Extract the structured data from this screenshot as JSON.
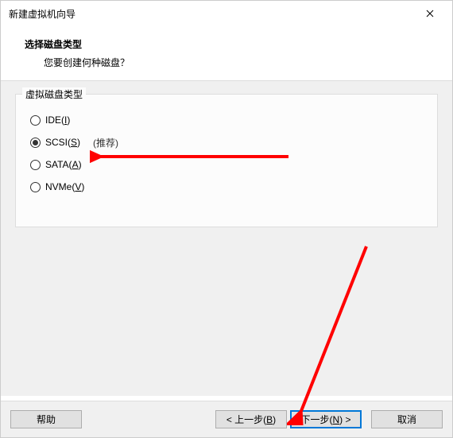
{
  "titlebar": {
    "title": "新建虚拟机向导"
  },
  "header": {
    "title": "选择磁盘类型",
    "subtitle": "您要创建何种磁盘？"
  },
  "group": {
    "label": "虚拟磁盘类型",
    "recommend": "(推荐)",
    "options": [
      {
        "text": "IDE(",
        "key": "I",
        "tail": ")",
        "checked": false
      },
      {
        "text": "SCSI(",
        "key": "S",
        "tail": ")",
        "checked": true
      },
      {
        "text": "SATA(",
        "key": "A",
        "tail": ")",
        "checked": false
      },
      {
        "text": "NVMe(",
        "key": "V",
        "tail": ")",
        "checked": false
      }
    ]
  },
  "footer": {
    "help": "帮助",
    "back_pre": "< 上一步(",
    "back_key": "B",
    "back_post": ")",
    "next_pre": "下一步(",
    "next_key": "N",
    "next_post": ") >",
    "cancel": "取消"
  }
}
